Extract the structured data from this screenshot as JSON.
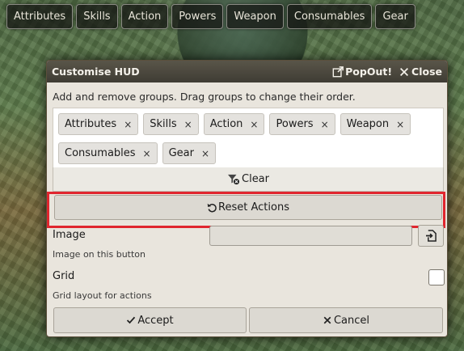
{
  "hud_bar": {
    "buttons": [
      "Attributes",
      "Skills",
      "Action",
      "Powers",
      "Weapon",
      "Consumables",
      "Gear"
    ]
  },
  "dialog": {
    "title": "Customise HUD",
    "popout_label": "PopOut!",
    "close_label": "Close",
    "hint": "Add and remove groups. Drag groups to change their order.",
    "tags_row1": [
      "Attributes",
      "Skills",
      "Action",
      "Powers",
      "Weapon"
    ],
    "tags_row2": [
      "Consumables",
      "Gear"
    ],
    "tag_remove_glyph": "×",
    "clear_label": "Clear",
    "reset_label": "Reset Actions",
    "image_label": "Image",
    "image_note": "Image on this button",
    "image_value": "",
    "grid_label": "Grid",
    "grid_note": "Grid layout for actions",
    "grid_checked": false,
    "accept_label": "Accept",
    "cancel_label": "Cancel"
  }
}
